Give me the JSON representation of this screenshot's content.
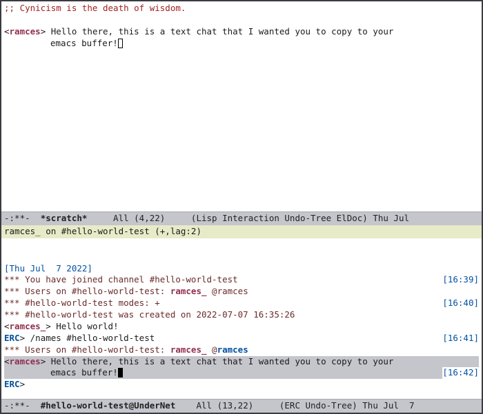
{
  "scratch": {
    "comment_line": ";; Cynicism is the death of wisdom.",
    "nick": "ramces",
    "msg_line1": "Hello there, this is a text chat that I wanted you to copy to your",
    "msg_line2": "emacs buffer!"
  },
  "modeline_top": {
    "prefix": "-:**-  ",
    "buffer": "*scratch*",
    "mid": "     All (4,22)     (Lisp Interaction Undo-Tree ElDoc) Thu Jul"
  },
  "channel_header": "ramces_ on #hello-world-test (+,lag:2)",
  "erc": {
    "date": "[Thu Jul  7 2022]",
    "join_msg": "*** You have joined channel #hello-world-test",
    "join_time": "[16:39]",
    "users_msg_prefix": "*** Users on #hello-world-test: ",
    "user1": "ramces_",
    "user2": "@ramces",
    "modes_msg": "*** #hello-world-test modes: +",
    "modes_time": "[16:40]",
    "created_msg": "*** #hello-world-test was created on 2022-07-07 16:35:26",
    "hello_nick": "ramces_",
    "hello_msg": "Hello world!",
    "erc_label": "ERC",
    "names_cmd": "/names #hello-world-test",
    "names_time": "[16:41]",
    "users2_prefix": "*** Users on #hello-world-test: ",
    "hi_nick": "ramces",
    "hi_line1": "Hello there, this is a text chat that I wanted you to copy to your",
    "hi_line2": "emacs buffer!",
    "hi_time": "[16:42]",
    "prompt": "ERC"
  },
  "modeline_bottom": {
    "prefix": "-:**-  ",
    "buffer": "#hello-world-test@UnderNet",
    "mid": "    All (13,22)     (ERC Undo-Tree) Thu Jul  7 "
  }
}
